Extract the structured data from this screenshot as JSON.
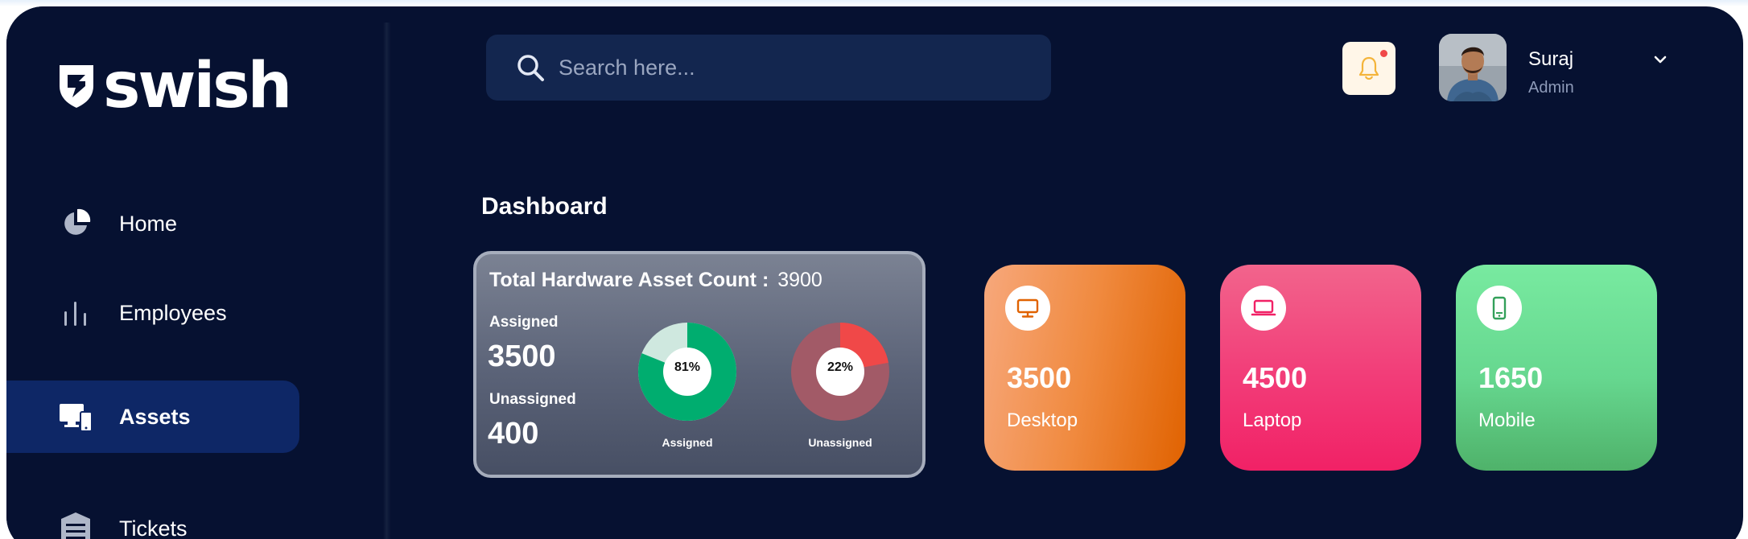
{
  "brand": {
    "name": "swish"
  },
  "nav": {
    "items": [
      {
        "label": "Home",
        "icon": "pie-chart-icon"
      },
      {
        "label": "Employees",
        "icon": "bar-chart-icon"
      },
      {
        "label": "Assets",
        "icon": "devices-icon",
        "active": true
      },
      {
        "label": "Tickets",
        "icon": "ticket-icon"
      }
    ]
  },
  "search": {
    "placeholder": "Search here..."
  },
  "user": {
    "name": "Suraj",
    "role": "Admin"
  },
  "page": {
    "title": "Dashboard"
  },
  "summary": {
    "title": "Total Hardware Asset Count :",
    "total": "3900",
    "assigned_label": "Assigned",
    "assigned_value": "3500",
    "unassigned_label": "Unassigned",
    "unassigned_value": "400",
    "assigned_chart": {
      "percent": 81,
      "text": "81%",
      "caption": "Assigned",
      "color": "#00ad6f"
    },
    "unassigned_chart": {
      "percent": 22,
      "text": "22%",
      "caption": "Unassigned",
      "color": "#f04848"
    }
  },
  "stats": [
    {
      "value": "3500",
      "label": "Desktop",
      "icon": "monitor-icon",
      "color": "#e06200"
    },
    {
      "value": "4500",
      "label": "Laptop",
      "icon": "laptop-icon",
      "color": "#f12166"
    },
    {
      "value": "1650",
      "label": "Mobile",
      "icon": "mobile-icon",
      "color": "#33a05a"
    }
  ],
  "colors": {
    "background": "#061131",
    "active_nav": "#0e2766",
    "search_bg": "#13264f",
    "notification_dot": "#f04848"
  }
}
